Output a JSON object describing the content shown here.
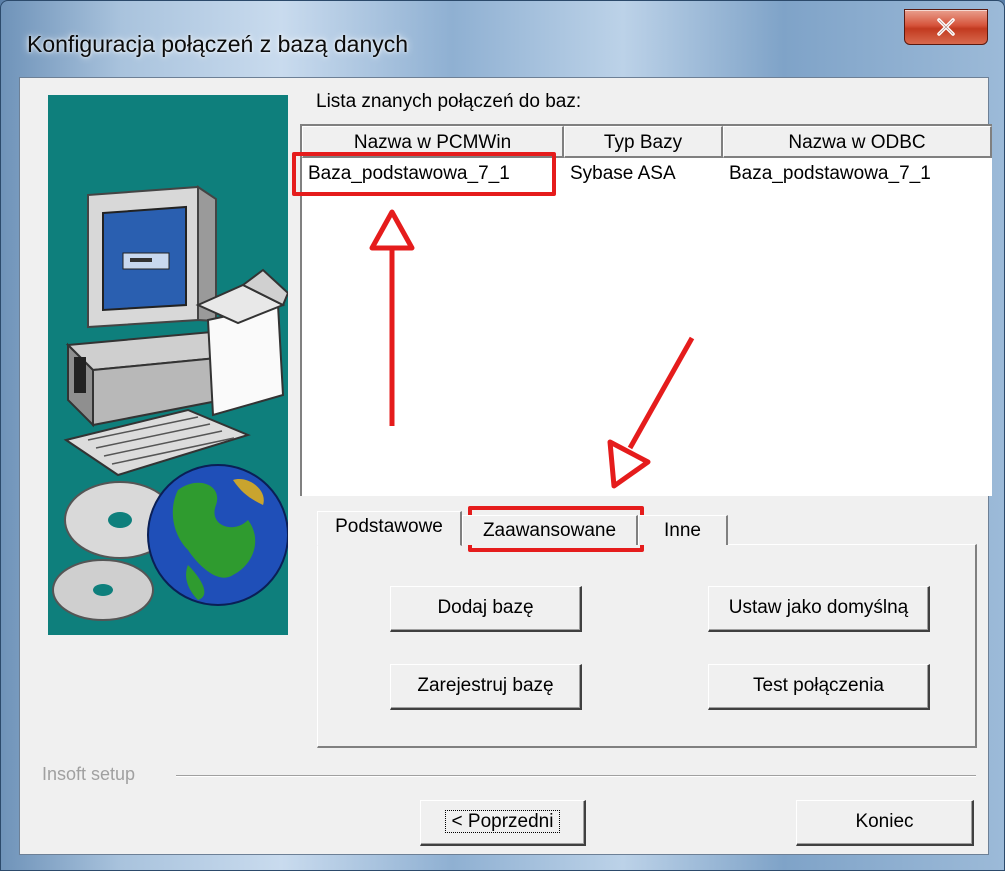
{
  "window": {
    "title": "Konfiguracja połączeń z bazą danych"
  },
  "list": {
    "caption": "Lista znanych połączeń do baz:",
    "columns": [
      "Nazwa w PCMWin",
      "Typ Bazy",
      "Nazwa w ODBC"
    ],
    "rows": [
      [
        "Baza_podstawowa_7_1",
        "Sybase ASA",
        "Baza_podstawowa_7_1"
      ]
    ]
  },
  "tabs": [
    "Podstawowe",
    "Zaawansowane",
    "Inne"
  ],
  "buttons": {
    "add_db": "Dodaj bazę",
    "set_default": "Ustaw jako domyślną",
    "register_db": "Zarejestruj bazę",
    "test_connection": "Test połączenia",
    "previous": "< Poprzedni",
    "finish": "Koniec"
  },
  "footer": {
    "group_caption": "Insoft setup"
  },
  "colors": {
    "highlight": "#e51c1c",
    "banner": "#0e7f7c"
  }
}
